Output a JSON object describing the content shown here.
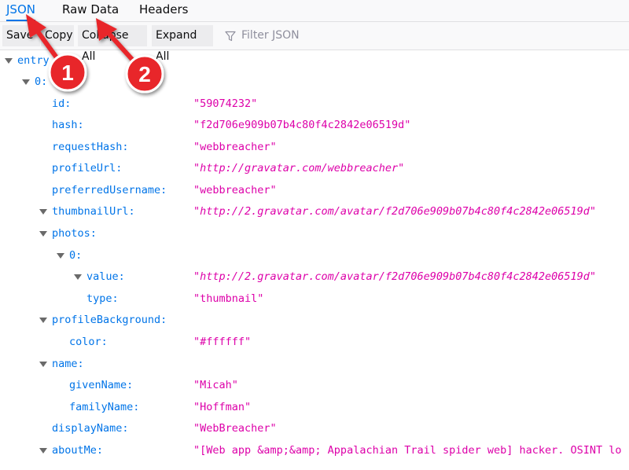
{
  "tabs": {
    "json": "JSON",
    "raw_data": "Raw Data",
    "headers": "Headers"
  },
  "toolbar": {
    "save": "Save",
    "copy": "Copy",
    "collapse_all": "Collapse All",
    "expand_all": "Expand All",
    "filter_placeholder": "Filter JSON"
  },
  "tree": {
    "entry_key": "entry",
    "index0_key": "0:",
    "id_key": "id:",
    "id_val": "\"59074232\"",
    "hash_key": "hash:",
    "hash_val": "\"f2d706e909b07b4c80f4c2842e06519d\"",
    "requesthash_key": "requestHash:",
    "requesthash_val": "\"webbreacher\"",
    "profileurl_key": "profileUrl:",
    "profileurl_val": "\"http://gravatar.com/webbreacher\"",
    "prefusername_key": "preferredUsername:",
    "prefusername_val": "\"webbreacher\"",
    "thumbnailurl_key": "thumbnailUrl:",
    "thumbnailurl_val": "\"http://2.gravatar.com/avatar/f2d706e909b07b4c80f4c2842e06519d\"",
    "photos_key": "photos:",
    "photos0_key": "0:",
    "value_key": "value:",
    "value_val": "\"http://2.gravatar.com/avatar/f2d706e909b07b4c80f4c2842e06519d\"",
    "type_key": "type:",
    "type_val": "\"thumbnail\"",
    "profilebg_key": "profileBackground:",
    "color_key": "color:",
    "color_val": "\"#ffffff\"",
    "name_key": "name:",
    "givenname_key": "givenName:",
    "givenname_val": "\"Micah\"",
    "familyname_key": "familyName:",
    "familyname_val": "\"Hoffman\"",
    "displayname_key": "displayName:",
    "displayname_val": "\"WebBreacher\"",
    "aboutme_key": "aboutMe:",
    "aboutme_val": "\"[Web app &amp;&amp; Appalachian Trail spider web] hacker. OSINT lo"
  },
  "annotations": {
    "marker1": "1",
    "marker2": "2"
  },
  "colors": {
    "accent": "#0074e8",
    "string": "#dd00a9",
    "marker": "#e8272a"
  }
}
